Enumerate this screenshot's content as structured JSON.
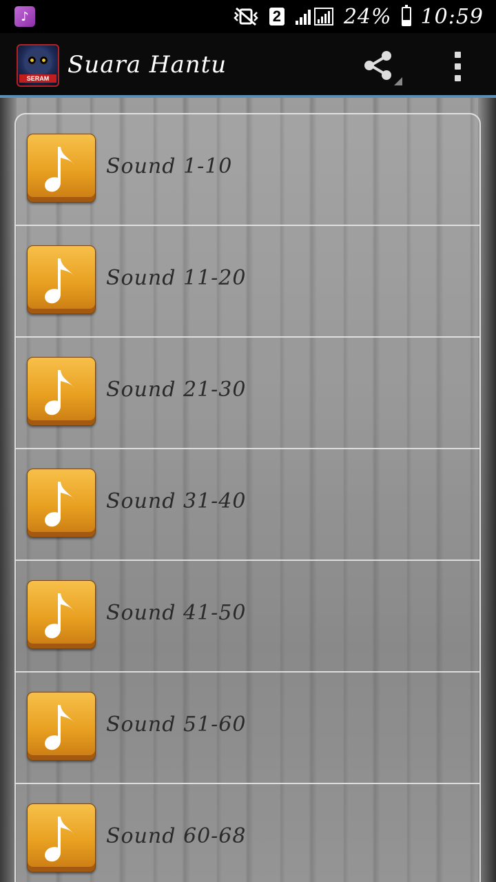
{
  "status_bar": {
    "notification_icon": "music-note-icon",
    "mute_icon": "vibrate-mute-icon",
    "sim_badge": "2",
    "battery_percent": "24%",
    "time": "10:59"
  },
  "action_bar": {
    "title": "Suara Hantu",
    "logo_text": "SERAM",
    "share_icon": "share-icon",
    "overflow_icon": "overflow-menu-icon"
  },
  "list": {
    "item_icon": "music-note-icon",
    "items": [
      {
        "label": "Sound 1-10"
      },
      {
        "label": "Sound 11-20"
      },
      {
        "label": "Sound 21-30"
      },
      {
        "label": "Sound 31-40"
      },
      {
        "label": "Sound 41-50"
      },
      {
        "label": "Sound 51-60"
      },
      {
        "label": "Sound 60-68"
      }
    ]
  },
  "colors": {
    "action_bar_bg": "#0b0b0b",
    "action_bar_divider": "#5b8fb3",
    "icon_orange": "#e8a021",
    "label_text": "#2a2a2a"
  }
}
